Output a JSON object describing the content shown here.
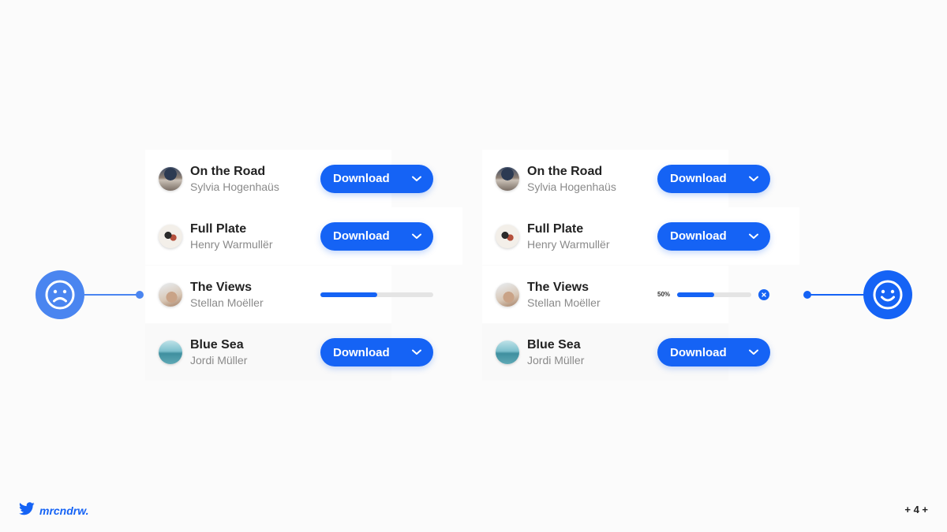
{
  "colors": {
    "accent": "#1563f5",
    "accent_light": "#4a85f0",
    "bg": "#fbfbfb"
  },
  "icons": {
    "before": "sad-face-icon",
    "after": "happy-face-icon",
    "brand": "twitter-bird-icon",
    "dropdown": "chevron-down-icon",
    "cancel": "close-icon"
  },
  "before": {
    "items": [
      {
        "title": "On the Road",
        "artist": "Sylvia Hogenhaüs",
        "button_label": "Download"
      },
      {
        "title": "Full Plate",
        "artist": "Henry Warmullër",
        "button_label": "Download"
      },
      {
        "title": "The Views",
        "artist": "Stellan Moëller",
        "progress": 0.5
      },
      {
        "title": "Blue Sea",
        "artist": "Jordi Müller",
        "button_label": "Download"
      }
    ]
  },
  "after": {
    "items": [
      {
        "title": "On the Road",
        "artist": "Sylvia Hogenhaüs",
        "button_label": "Download"
      },
      {
        "title": "Full Plate",
        "artist": "Henry Warmullër",
        "button_label": "Download"
      },
      {
        "title": "The Views",
        "artist": "Stellan Moëller",
        "progress": 0.5,
        "progress_label": "50%"
      },
      {
        "title": "Blue Sea",
        "artist": "Jordi Müller",
        "button_label": "Download"
      }
    ]
  },
  "footer": {
    "handle": "mrcndrw.",
    "page": "+ 4 +"
  }
}
